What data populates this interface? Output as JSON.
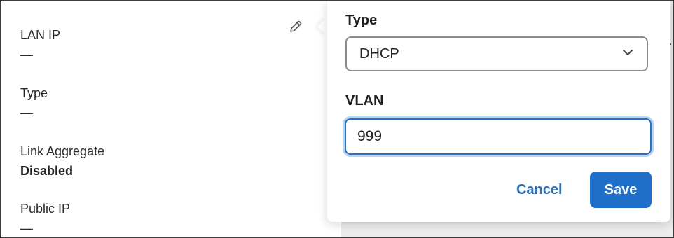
{
  "left_panel": {
    "fields": [
      {
        "label": "LAN IP",
        "value": "—"
      },
      {
        "label": "Type",
        "value": "—"
      },
      {
        "label": "Link Aggregate",
        "value": "Disabled"
      },
      {
        "label": "Public IP",
        "value": "—"
      }
    ],
    "edit_icon": "pencil-icon"
  },
  "popover": {
    "type_label": "Type",
    "type_value": "DHCP",
    "type_icon": "chevron-down-icon",
    "vlan_label": "VLAN",
    "vlan_value": "999",
    "cancel_label": "Cancel",
    "save_label": "Save"
  },
  "colors": {
    "accent": "#1f6fca",
    "focus_ring": "#b9d4f2",
    "cancel_text": "#2d6db4"
  }
}
